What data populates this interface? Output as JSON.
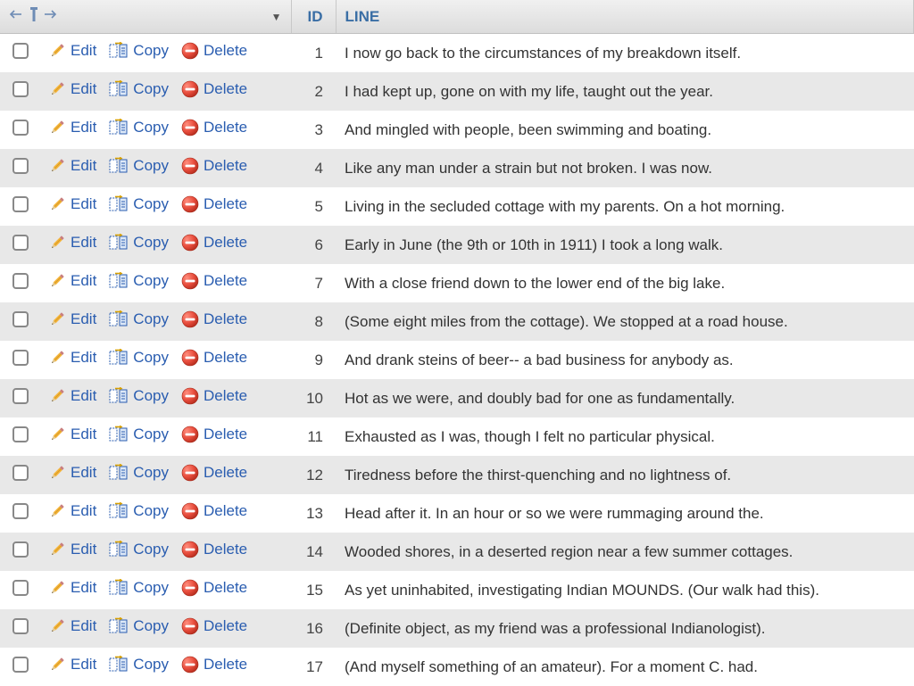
{
  "header": {
    "id_label": "ID",
    "line_label": "LINE"
  },
  "actions": {
    "edit": "Edit",
    "copy": "Copy",
    "delete": "Delete"
  },
  "rows": [
    {
      "id": "1",
      "line": "I now go back to the circumstances of my breakdown itself."
    },
    {
      "id": "2",
      "line": "I had kept up, gone on with my life, taught out the year."
    },
    {
      "id": "3",
      "line": "And mingled with people, been swimming and boating."
    },
    {
      "id": "4",
      "line": "Like any man under a strain but not broken. I was now."
    },
    {
      "id": "5",
      "line": "Living in the secluded cottage with my parents. On a hot morning."
    },
    {
      "id": "6",
      "line": "Early in June (the 9th or 10th in 1911) I took a long walk."
    },
    {
      "id": "7",
      "line": "With a close friend down to the lower end of the big lake."
    },
    {
      "id": "8",
      "line": "(Some eight miles from the cottage). We stopped at a road house."
    },
    {
      "id": "9",
      "line": "And drank steins of beer-- a bad business for anybody as."
    },
    {
      "id": "10",
      "line": "Hot as we were, and doubly bad for one as fundamentally."
    },
    {
      "id": "11",
      "line": "Exhausted as I was, though I felt no particular physical."
    },
    {
      "id": "12",
      "line": "Tiredness before the thirst-quenching and no lightness of."
    },
    {
      "id": "13",
      "line": "Head after it. In an hour or so we were rummaging around the."
    },
    {
      "id": "14",
      "line": "Wooded shores, in a deserted region near a few summer cottages."
    },
    {
      "id": "15",
      "line": "As yet uninhabited, investigating Indian MOUNDS. (Our walk had this)."
    },
    {
      "id": "16",
      "line": "(Definite object, as my friend was a professional Indianologist)."
    },
    {
      "id": "17",
      "line": "(And myself something of an amateur). For a moment C. had."
    }
  ]
}
